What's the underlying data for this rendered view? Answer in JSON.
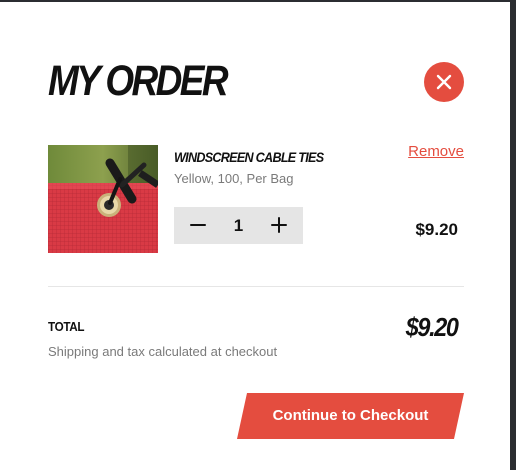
{
  "order": {
    "title": "MY ORDER"
  },
  "item": {
    "name": "WINDSCREEN CABLE TIES",
    "variant": "Yellow, 100, Per Bag",
    "remove_label": "Remove",
    "quantity": "1",
    "price": "$9.20",
    "image": "red-windscreen-fabric-with-grommet-and-cable-tie"
  },
  "summary": {
    "total_label": "TOTAL",
    "total_value": "$9.20",
    "shipping_note": "Shipping and tax calculated at checkout"
  },
  "actions": {
    "checkout_label": "Continue to Checkout"
  },
  "icons": {
    "close": "close-icon",
    "minus": "minus-icon",
    "plus": "plus-icon"
  },
  "colors": {
    "accent": "#e44d3f",
    "text": "#111111",
    "muted": "#7a7a7a",
    "stepper_bg": "#e5e5e5"
  }
}
